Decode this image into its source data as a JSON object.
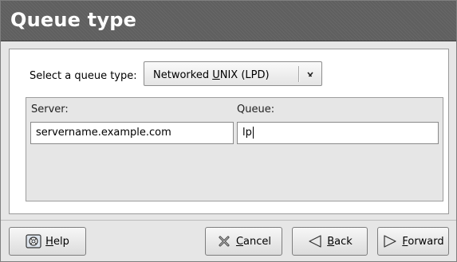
{
  "header": {
    "title": "Queue type"
  },
  "queue_type": {
    "label": "Select a queue type:",
    "selected_prefix": "Networked ",
    "selected_mnemonic": "U",
    "selected_suffix": "NIX (LPD)"
  },
  "fields": {
    "server_label": "Server:",
    "server_value": "servername.example.com",
    "queue_label": "Queue:",
    "queue_value": "lp"
  },
  "buttons": {
    "help": {
      "mnemonic": "H",
      "rest": "elp"
    },
    "cancel": {
      "mnemonic": "C",
      "rest": "ancel"
    },
    "back": {
      "mnemonic": "B",
      "rest": "ack"
    },
    "forward": {
      "mnemonic": "F",
      "rest": "orward"
    }
  }
}
